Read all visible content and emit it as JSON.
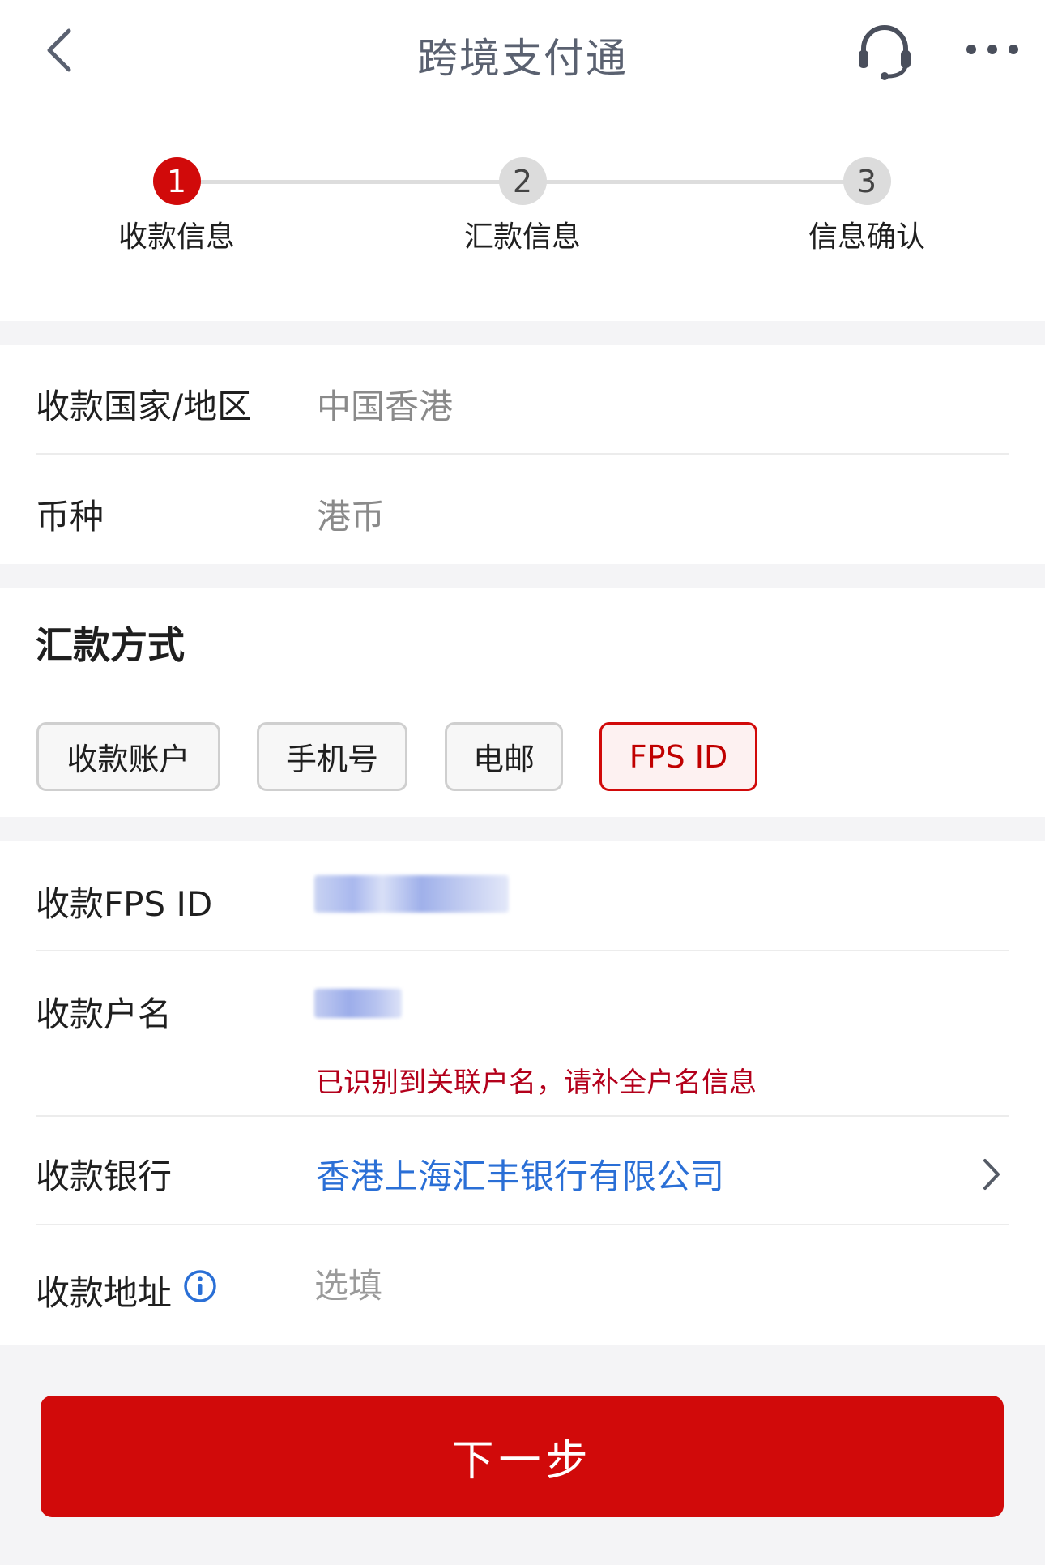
{
  "header": {
    "title": "跨境支付通",
    "back_icon": "chevron-left-icon",
    "cs_icon": "headset-icon",
    "more_icon": "more-dots-icon"
  },
  "steps": [
    {
      "number": "1",
      "label": "收款信息",
      "status": "active"
    },
    {
      "number": "2",
      "label": "汇款信息",
      "status": "inactive"
    },
    {
      "number": "3",
      "label": "信息确认",
      "status": "inactive"
    }
  ],
  "region": {
    "country_label": "收款国家/地区",
    "country_value": "中国香港",
    "currency_label": "币种",
    "currency_value": "港币"
  },
  "method": {
    "title": "汇款方式",
    "options": [
      {
        "label": "收款账户",
        "selected": false
      },
      {
        "label": "手机号",
        "selected": false
      },
      {
        "label": "电邮",
        "selected": false
      },
      {
        "label": "FPS ID",
        "selected": true
      }
    ]
  },
  "payee": {
    "fps_label": "收款FPS ID",
    "name_label": "收款户名",
    "name_hint": "已识别到关联户名，请补全户名信息",
    "bank_label": "收款银行",
    "bank_value": "香港上海汇丰银行有限公司",
    "address_label": "收款地址",
    "address_placeholder": "选填",
    "info_icon": "info-icon",
    "bank_chevron_icon": "chevron-right-icon"
  },
  "actions": {
    "next_label": "下一步"
  },
  "colors": {
    "brand_red": "#d10a0a",
    "link_blue": "#2a6fd6",
    "warn_red": "#b3001b",
    "page_bg": "#f4f4f6"
  }
}
